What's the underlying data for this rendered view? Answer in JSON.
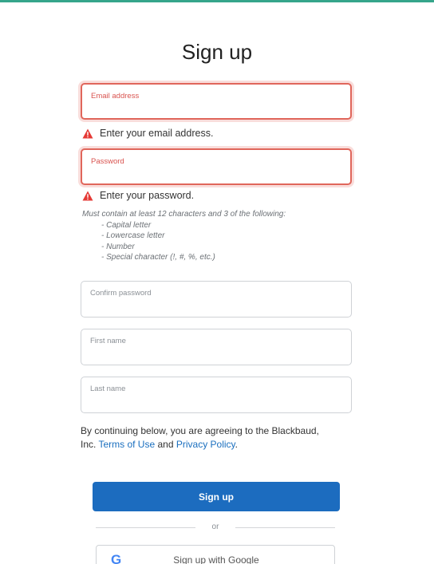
{
  "page": {
    "title": "Sign up"
  },
  "form": {
    "email": {
      "label": "Email address",
      "value": "",
      "error": "Enter your email address."
    },
    "password": {
      "label": "Password",
      "value": "",
      "error": "Enter your password."
    },
    "password_hint": {
      "intro": "Must contain at least 12 characters and 3 of the following:",
      "rules": [
        "- Capital letter",
        "- Lowercase letter",
        "- Number",
        "- Special character (!, #, %, etc.)"
      ]
    },
    "confirm_password": {
      "label": "Confirm password",
      "value": ""
    },
    "first_name": {
      "label": "First name",
      "value": ""
    },
    "last_name": {
      "label": "Last name",
      "value": ""
    }
  },
  "consent": {
    "text_1": "By continuing below, you are agreeing to the Blackbaud, Inc. ",
    "terms_link": "Terms of Use",
    "text_2": " and ",
    "privacy_link": "Privacy Policy",
    "text_3": "."
  },
  "actions": {
    "signup_label": "Sign up",
    "divider_label": "or",
    "google_label": "Sign up with Google",
    "google_icon_glyph": "G"
  },
  "colors": {
    "accent_bar": "#36a58b",
    "primary_button": "#1c6cbf",
    "error_border": "#e0665b",
    "warning_icon": "#e53935",
    "link": "#1a6fbf"
  },
  "icons": {
    "error": "warning-icon",
    "google": "google-icon"
  }
}
